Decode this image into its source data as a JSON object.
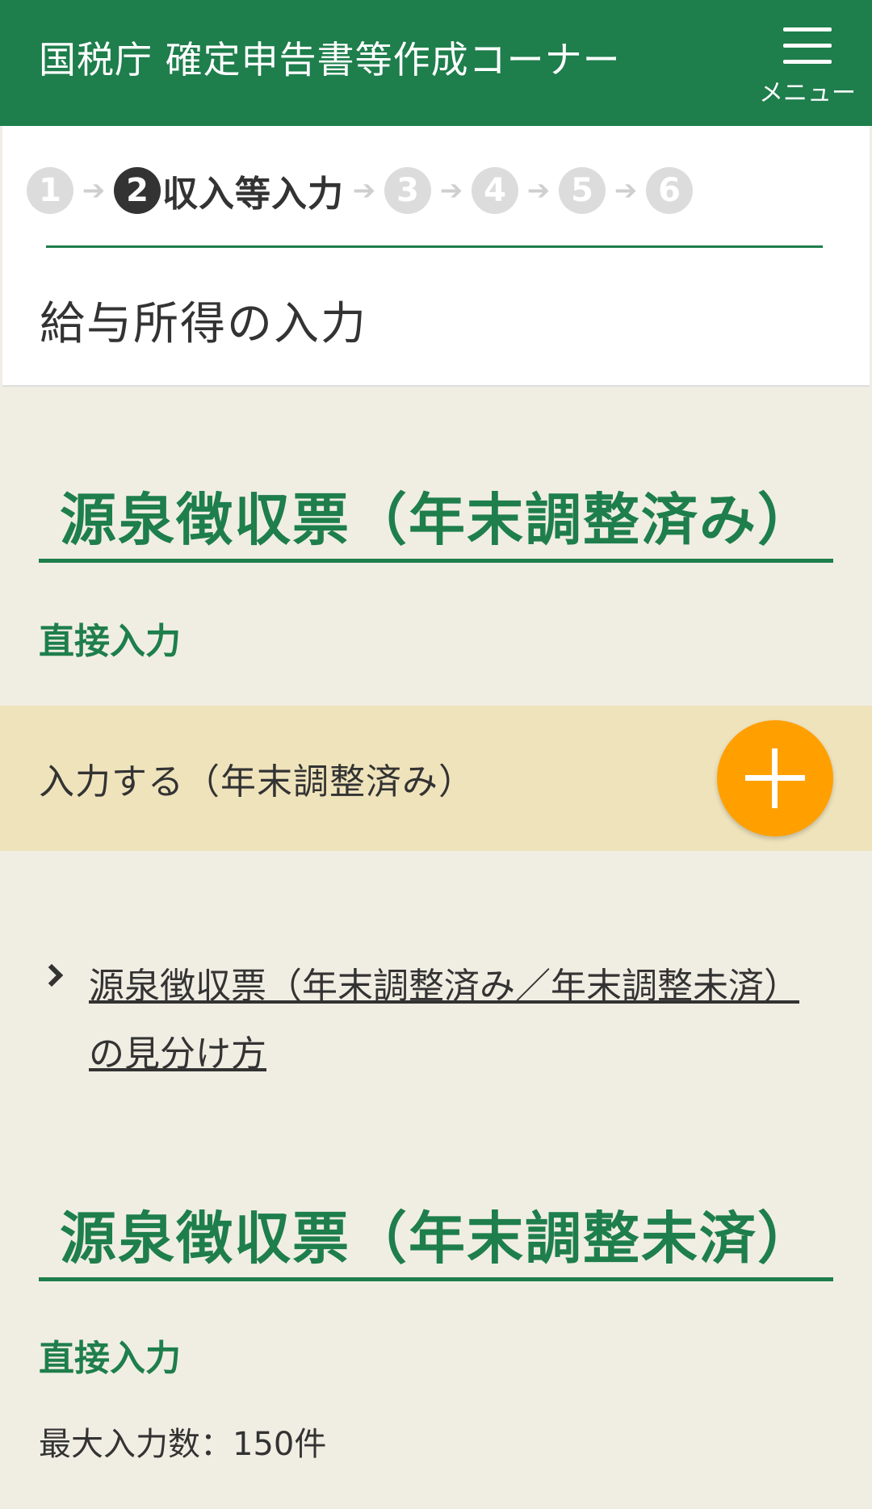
{
  "header": {
    "title": "国税庁 確定申告書等作成コーナー",
    "menu_label": "メニュー"
  },
  "steps": {
    "items": [
      "1",
      "2",
      "3",
      "4",
      "5",
      "6"
    ],
    "active_index": 1,
    "active_label": "収入等入力"
  },
  "page": {
    "title": "給与所得の入力"
  },
  "section1": {
    "title": "源泉徴収票（年末調整済み）",
    "sub_label": "直接入力",
    "input_label": "入力する（年末調整済み）",
    "link_text": "源泉徴収票（年末調整済み／年末調整未済）の見分け方"
  },
  "section2": {
    "title": "源泉徴収票（年末調整未済）",
    "sub_label": "直接入力",
    "max_label": "最大入力数：150件"
  },
  "colors": {
    "brand_green": "#1e7e4c",
    "accent_orange": "#ffa000",
    "input_row_bg": "#efe3bc",
    "page_bg": "#f0eee3"
  },
  "icons": {
    "menu": "hamburger-icon",
    "add": "plus-icon",
    "link": "chevron-right-icon"
  }
}
